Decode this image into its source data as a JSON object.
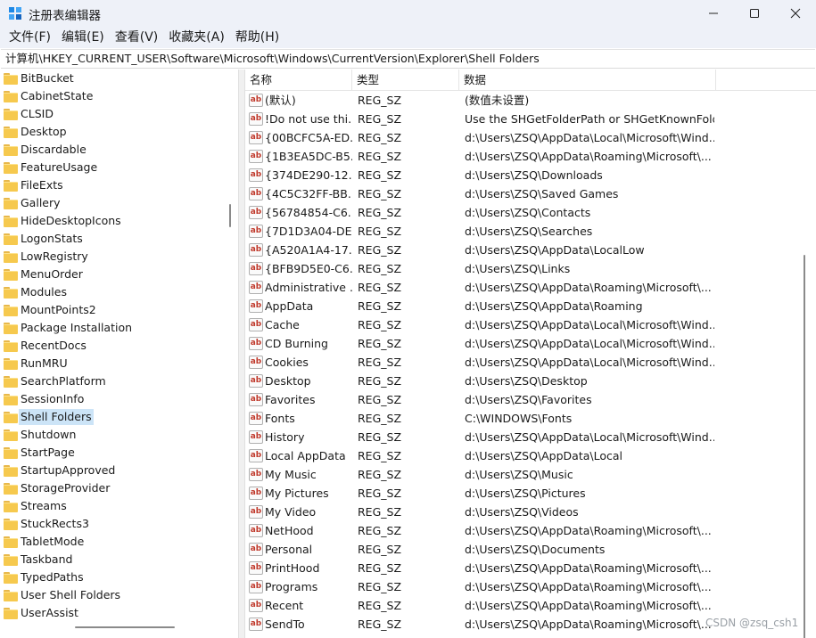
{
  "window": {
    "title": "注册表编辑器",
    "icon": "regedit-icon",
    "controls": {
      "minimize": "minimize-icon",
      "maximize": "maximize-icon",
      "close": "close-icon"
    }
  },
  "menu": [
    "文件(F)",
    "编辑(E)",
    "查看(V)",
    "收藏夹(A)",
    "帮助(H)"
  ],
  "address": "计算机\\HKEY_CURRENT_USER\\Software\\Microsoft\\Windows\\CurrentVersion\\Explorer\\Shell Folders",
  "tree": {
    "items": [
      "BitBucket",
      "CabinetState",
      "CLSID",
      "Desktop",
      "Discardable",
      "FeatureUsage",
      "FileExts",
      "Gallery",
      "HideDesktopIcons",
      "LogonStats",
      "LowRegistry",
      "MenuOrder",
      "Modules",
      "MountPoints2",
      "Package Installation",
      "RecentDocs",
      "RunMRU",
      "SearchPlatform",
      "SessionInfo",
      "Shell Folders",
      "Shutdown",
      "StartPage",
      "StartupApproved",
      "StorageProvider",
      "Streams",
      "StuckRects3",
      "TabletMode",
      "Taskband",
      "TypedPaths",
      "User Shell Folders",
      "UserAssist"
    ],
    "selected": "Shell Folders"
  },
  "list": {
    "headers": {
      "name": "名称",
      "type": "类型",
      "data": "数据"
    },
    "rows": [
      {
        "name": "(默认)",
        "type": "REG_SZ",
        "data": "(数值未设置)"
      },
      {
        "name": "!Do not use thi...",
        "type": "REG_SZ",
        "data": "Use the SHGetFolderPath or SHGetKnownFold..."
      },
      {
        "name": "{00BCFC5A-ED...",
        "type": "REG_SZ",
        "data": "d:\\Users\\ZSQ\\AppData\\Local\\Microsoft\\Wind..."
      },
      {
        "name": "{1B3EA5DC-B5...",
        "type": "REG_SZ",
        "data": "d:\\Users\\ZSQ\\AppData\\Roaming\\Microsoft\\..."
      },
      {
        "name": "{374DE290-12...",
        "type": "REG_SZ",
        "data": "d:\\Users\\ZSQ\\Downloads"
      },
      {
        "name": "{4C5C32FF-BB...",
        "type": "REG_SZ",
        "data": "d:\\Users\\ZSQ\\Saved Games"
      },
      {
        "name": "{56784854-C6...",
        "type": "REG_SZ",
        "data": "d:\\Users\\ZSQ\\Contacts"
      },
      {
        "name": "{7D1D3A04-DE...",
        "type": "REG_SZ",
        "data": "d:\\Users\\ZSQ\\Searches"
      },
      {
        "name": "{A520A1A4-17...",
        "type": "REG_SZ",
        "data": "d:\\Users\\ZSQ\\AppData\\LocalLow"
      },
      {
        "name": "{BFB9D5E0-C6...",
        "type": "REG_SZ",
        "data": "d:\\Users\\ZSQ\\Links"
      },
      {
        "name": "Administrative ...",
        "type": "REG_SZ",
        "data": "d:\\Users\\ZSQ\\AppData\\Roaming\\Microsoft\\..."
      },
      {
        "name": "AppData",
        "type": "REG_SZ",
        "data": "d:\\Users\\ZSQ\\AppData\\Roaming"
      },
      {
        "name": "Cache",
        "type": "REG_SZ",
        "data": "d:\\Users\\ZSQ\\AppData\\Local\\Microsoft\\Wind..."
      },
      {
        "name": "CD Burning",
        "type": "REG_SZ",
        "data": "d:\\Users\\ZSQ\\AppData\\Local\\Microsoft\\Wind..."
      },
      {
        "name": "Cookies",
        "type": "REG_SZ",
        "data": "d:\\Users\\ZSQ\\AppData\\Local\\Microsoft\\Wind..."
      },
      {
        "name": "Desktop",
        "type": "REG_SZ",
        "data": "d:\\Users\\ZSQ\\Desktop"
      },
      {
        "name": "Favorites",
        "type": "REG_SZ",
        "data": "d:\\Users\\ZSQ\\Favorites"
      },
      {
        "name": "Fonts",
        "type": "REG_SZ",
        "data": "C:\\WINDOWS\\Fonts"
      },
      {
        "name": "History",
        "type": "REG_SZ",
        "data": "d:\\Users\\ZSQ\\AppData\\Local\\Microsoft\\Wind..."
      },
      {
        "name": "Local AppData",
        "type": "REG_SZ",
        "data": "d:\\Users\\ZSQ\\AppData\\Local"
      },
      {
        "name": "My Music",
        "type": "REG_SZ",
        "data": "d:\\Users\\ZSQ\\Music"
      },
      {
        "name": "My Pictures",
        "type": "REG_SZ",
        "data": "d:\\Users\\ZSQ\\Pictures"
      },
      {
        "name": "My Video",
        "type": "REG_SZ",
        "data": "d:\\Users\\ZSQ\\Videos"
      },
      {
        "name": "NetHood",
        "type": "REG_SZ",
        "data": "d:\\Users\\ZSQ\\AppData\\Roaming\\Microsoft\\..."
      },
      {
        "name": "Personal",
        "type": "REG_SZ",
        "data": "d:\\Users\\ZSQ\\Documents"
      },
      {
        "name": "PrintHood",
        "type": "REG_SZ",
        "data": "d:\\Users\\ZSQ\\AppData\\Roaming\\Microsoft\\..."
      },
      {
        "name": "Programs",
        "type": "REG_SZ",
        "data": "d:\\Users\\ZSQ\\AppData\\Roaming\\Microsoft\\..."
      },
      {
        "name": "Recent",
        "type": "REG_SZ",
        "data": "d:\\Users\\ZSQ\\AppData\\Roaming\\Microsoft\\..."
      },
      {
        "name": "SendTo",
        "type": "REG_SZ",
        "data": "d:\\Users\\ZSQ\\AppData\\Roaming\\Microsoft\\..."
      }
    ],
    "value_icon": "reg-sz-icon",
    "value_icon_text": "ab"
  },
  "watermark": "CSDN @zsq_csh1",
  "colors": {
    "selection": "#cce4f7",
    "folder": "#f6c94e",
    "chrome": "#eef1f8"
  }
}
